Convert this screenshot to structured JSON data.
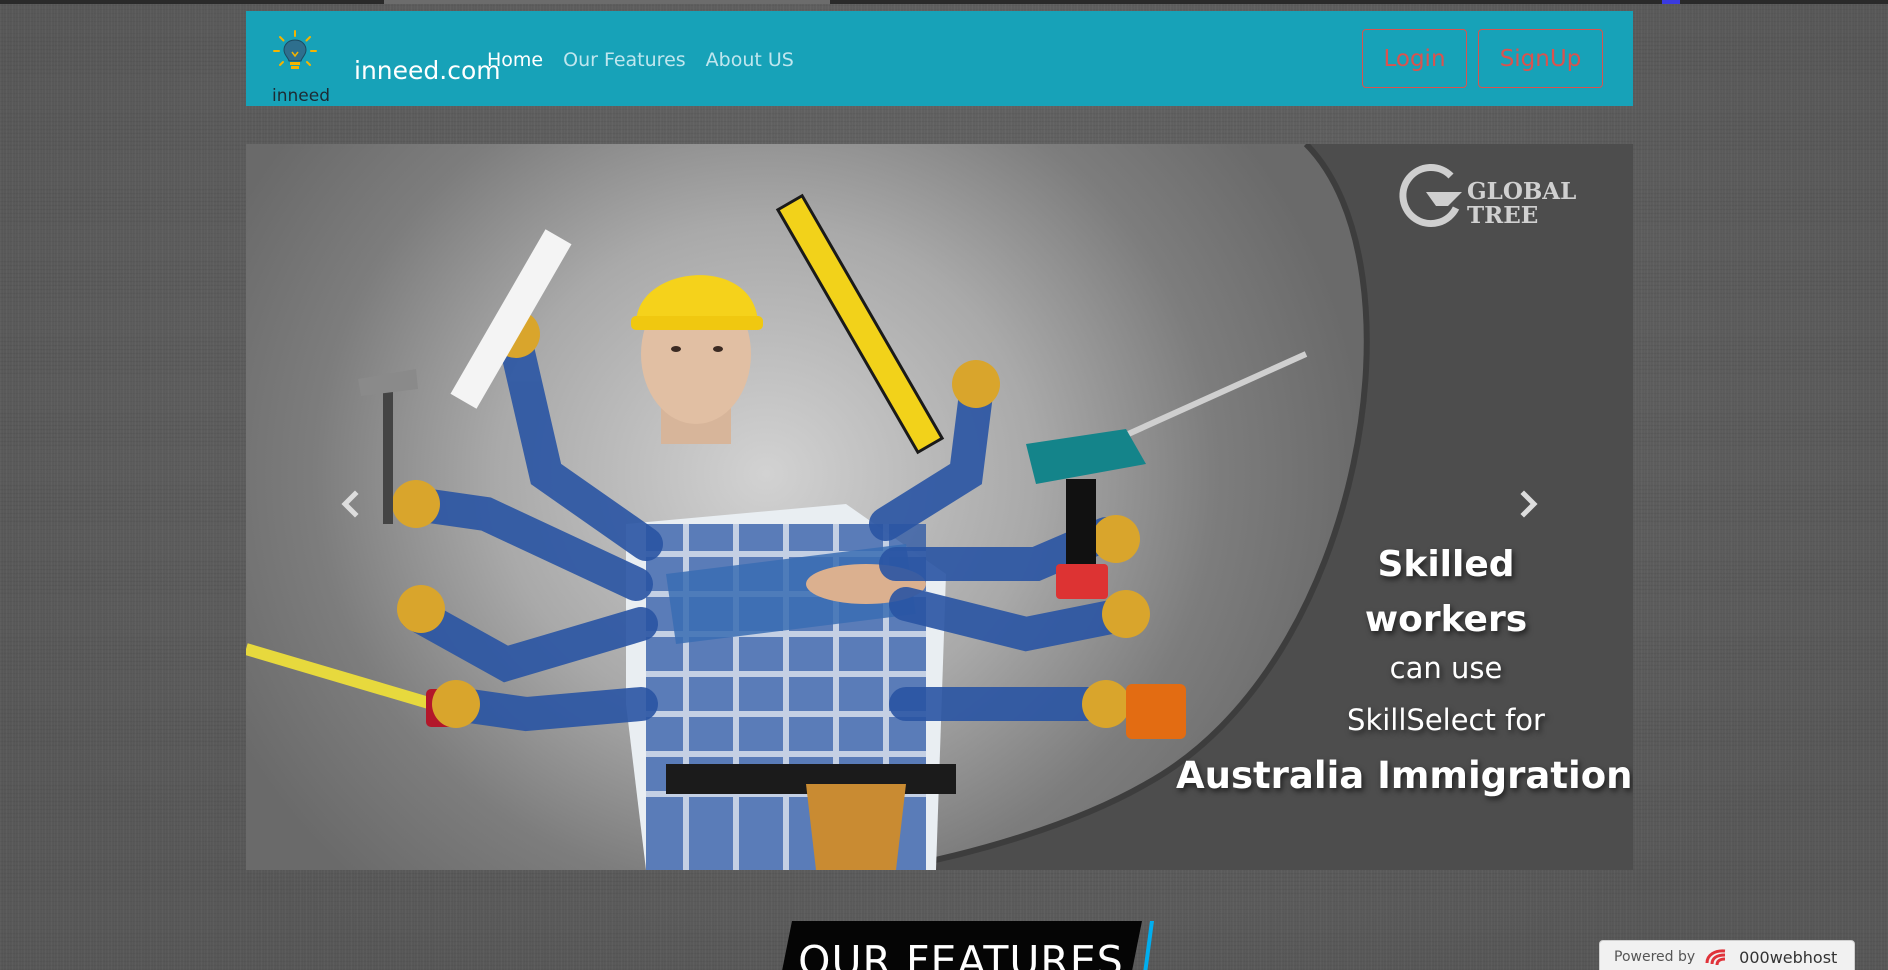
{
  "navbar": {
    "brand_name": "inneed.com",
    "brand_logo_text": "inneed",
    "links": [
      {
        "label": "Home",
        "active": true
      },
      {
        "label": "Our Features",
        "active": false
      },
      {
        "label": "About US",
        "active": false
      }
    ],
    "login_label": "Login",
    "signup_label": "SignUp",
    "accent_color": "#17a2b8",
    "button_color": "#d9534f"
  },
  "carousel": {
    "prev_icon": "chevron-left-icon",
    "next_icon": "chevron-right-icon",
    "slide": {
      "logo_text": "GLOBAL\nTREE",
      "caption": {
        "line1": "Skilled",
        "line2": "workers",
        "line3": "can use",
        "line4": "SkillSelect for",
        "line5": "Australia Immigration"
      }
    }
  },
  "features": {
    "heading": "OUR FEATURES",
    "accent_color": "#00aeef"
  },
  "powered_badge": {
    "label": "Powered by",
    "host": "000webhost"
  }
}
